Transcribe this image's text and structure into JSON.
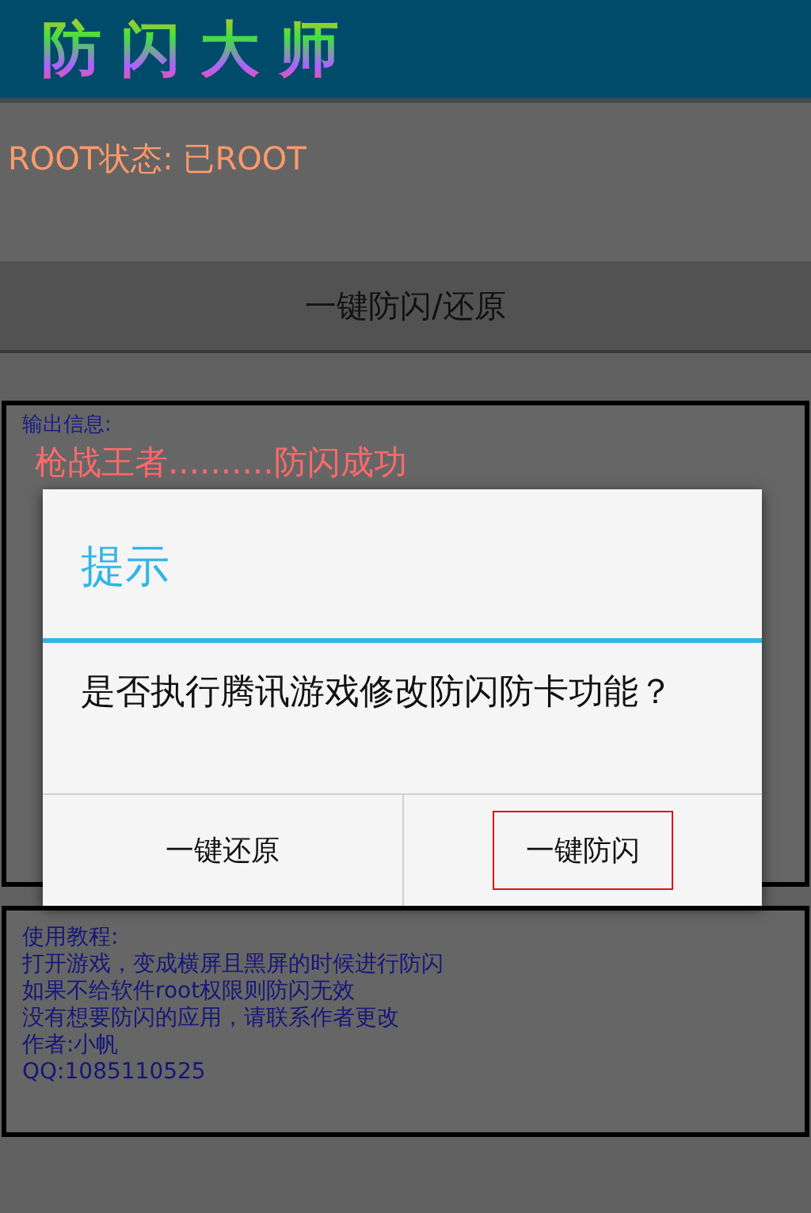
{
  "app_title": "防闪大师",
  "root_status": "ROOT状态: 已ROOT",
  "main_button": "一键防闪/还原",
  "output": {
    "label": "输出信息:",
    "lines": [
      "枪战王者..........防闪成功"
    ]
  },
  "dialog": {
    "title": "提示",
    "message": "是否执行腾讯游戏修改防闪防卡功能？",
    "buttons": [
      {
        "label": "一键还原",
        "selected": false
      },
      {
        "label": "一键防闪",
        "selected": true
      }
    ]
  },
  "tutorial": {
    "lines": [
      "使用教程:",
      "打开游戏，变成横屏且黑屏的时候进行防闪",
      "如果不给软件root权限则防闪无效",
      "没有想要防闪的应用，请联系作者更改",
      "作者:小帆",
      "QQ:1085110525"
    ]
  }
}
